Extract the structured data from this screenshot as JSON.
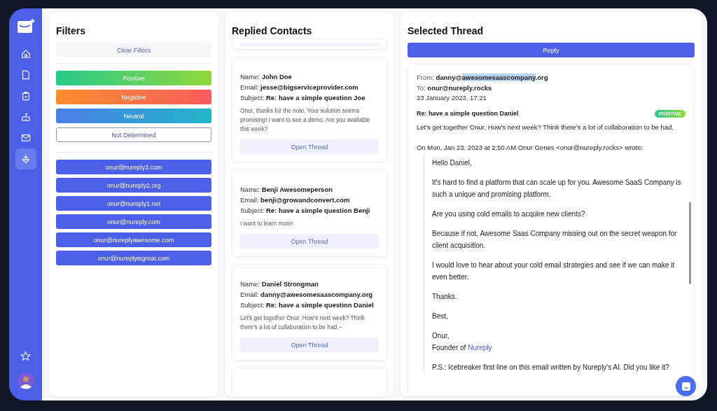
{
  "sidebar": {
    "items": [
      {
        "kind": "home",
        "selected": false
      },
      {
        "kind": "file",
        "selected": false
      },
      {
        "kind": "clipboard",
        "selected": false
      },
      {
        "kind": "inbox",
        "selected": false
      },
      {
        "kind": "mail",
        "selected": false
      },
      {
        "kind": "download",
        "selected": true
      }
    ]
  },
  "filters": {
    "title": "Filters",
    "clear": "Clear Filters",
    "sentiments": [
      {
        "label": "Positive",
        "kind": "positive"
      },
      {
        "label": "Negative",
        "kind": "negative"
      },
      {
        "label": "Neutral",
        "kind": "neutral"
      },
      {
        "label": "Not Determined",
        "kind": "undetermined"
      }
    ],
    "accounts": [
      "onur@nureply3.com",
      "onur@nureply2.org",
      "onur@nureply1.net",
      "onur@nureply.com",
      "onur@nureplyawesome.com",
      "onur@nureplyisgreat.com"
    ]
  },
  "contacts": {
    "title": "Replied Contacts",
    "cards": [
      {
        "name": "Name: **John Doe**",
        "email": "Email: **jesse@bigserviceprovider.com**",
        "subject": "Subject: **Re: have a simple question Joe**",
        "snippet": "Onur, thanks for the note. Your solution seems promising! I want to see a demo. Are you available this week?",
        "button": "Open Thread"
      },
      {
        "name": "Name: **Benji Awesomeperson**",
        "email": "Email: **benji@growandconvert.com**",
        "subject": "Subject: **Re: have a simple question Benji**",
        "snippet": "I want to learn more!",
        "button": "Open Thread"
      },
      {
        "name": "Name: **Daniel Strongman**",
        "email": "Email: **danny@awesomesaascompany.org**",
        "subject": "Subject: **Re: have a simple question Daniel**",
        "snippet": "Let's get together Onur. How's next week? Think there's a lot of collaboration to be had.--",
        "button": "Open Thread"
      }
    ]
  },
  "thread": {
    "title": "Selected Thread",
    "reply": "Reply",
    "from_label": "From:",
    "from_before": "danny@",
    "from_selected": "awesomesaascompany",
    "from_after": ".org",
    "to_label": "To:",
    "to": "onur@nureply.rocks",
    "date": "23 January 2023, 17:21",
    "subject": "Re: have a simple question Daniel",
    "badge": "POSITIVE",
    "body": "Let's get together Onur. How's next week? Think there's a lot of collaboration to be had.",
    "quote_header": "On Mon, Jan 23, 2023 at 2:50 AM Onur Genes <onur@nureply.rocks> wrote:",
    "quote": [
      {
        "kind": "text",
        "text": "Hello Daniel,"
      },
      {
        "kind": "text",
        "text": "It's hard to find a platform that can scale up for you. Awesome SaaS Company is such a unique and promising platform."
      },
      {
        "kind": "text",
        "text": "Are you using cold emails to acquire new clients?"
      },
      {
        "kind": "text",
        "text": "Because if not, Awesome Saas Company missing out on the secret weapon for client acquisition."
      },
      {
        "kind": "text",
        "text": "I would love to hear about your cold email strategies and see if we can make it even better."
      },
      {
        "kind": "text",
        "text": "Thanks."
      },
      {
        "kind": "text",
        "text": "Best,"
      },
      {
        "kind": "signature",
        "text": "Onur,",
        "prefix": "Founder of",
        "link": "Nureply"
      },
      {
        "kind": "text",
        "text": "P.S.: Icebreaker first line on this email written by Nureply's AI. Did you like it?"
      }
    ]
  }
}
